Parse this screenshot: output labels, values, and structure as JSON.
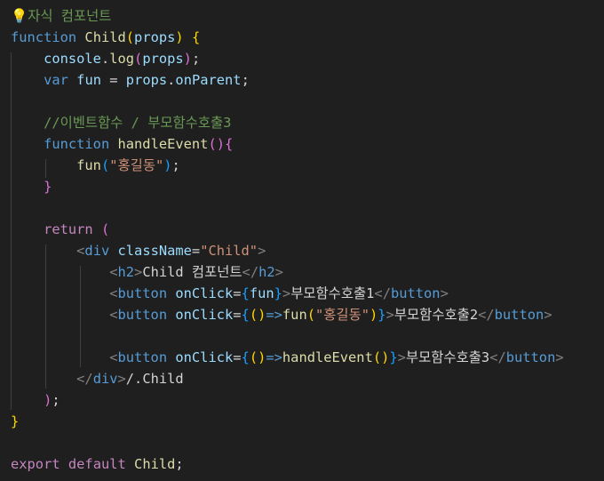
{
  "editor": {
    "language": "jsx",
    "theme_background": "#1f1f1f",
    "lines": [
      {
        "tokens": [
          {
            "t": "💡",
            "c": "bulb",
            "icon": "lightbulb-icon"
          },
          {
            "t": "자식 컴포넌트",
            "c": "c-comment"
          }
        ]
      },
      {
        "tokens": [
          {
            "t": "function",
            "c": "c-kw"
          },
          {
            "t": " ",
            "c": "c-text"
          },
          {
            "t": "Child",
            "c": "c-fn"
          },
          {
            "t": "(",
            "c": "b1"
          },
          {
            "t": "props",
            "c": "c-var"
          },
          {
            "t": ")",
            "c": "b1"
          },
          {
            "t": " ",
            "c": "c-text"
          },
          {
            "t": "{",
            "c": "b1"
          }
        ]
      },
      {
        "tokens": [
          {
            "t": "    ",
            "c": "c-text"
          },
          {
            "t": "console",
            "c": "c-var"
          },
          {
            "t": ".",
            "c": "c-text"
          },
          {
            "t": "log",
            "c": "c-fn"
          },
          {
            "t": "(",
            "c": "b2"
          },
          {
            "t": "props",
            "c": "c-var"
          },
          {
            "t": ")",
            "c": "b2"
          },
          {
            "t": ";",
            "c": "c-text"
          }
        ]
      },
      {
        "tokens": [
          {
            "t": "    ",
            "c": "c-text"
          },
          {
            "t": "var",
            "c": "c-kw"
          },
          {
            "t": " ",
            "c": "c-text"
          },
          {
            "t": "fun",
            "c": "c-var"
          },
          {
            "t": " = ",
            "c": "c-text"
          },
          {
            "t": "props",
            "c": "c-var"
          },
          {
            "t": ".",
            "c": "c-text"
          },
          {
            "t": "onParent",
            "c": "c-var"
          },
          {
            "t": ";",
            "c": "c-text"
          }
        ]
      },
      {
        "tokens": []
      },
      {
        "tokens": [
          {
            "t": "    ",
            "c": "c-text"
          },
          {
            "t": "//이벤트함수 / 부모함수호출3",
            "c": "c-comment"
          }
        ]
      },
      {
        "tokens": [
          {
            "t": "    ",
            "c": "c-text"
          },
          {
            "t": "function",
            "c": "c-kw"
          },
          {
            "t": " ",
            "c": "c-text"
          },
          {
            "t": "handleEvent",
            "c": "c-fn"
          },
          {
            "t": "()",
            "c": "b2"
          },
          {
            "t": "{",
            "c": "b2"
          }
        ]
      },
      {
        "tokens": [
          {
            "t": "        ",
            "c": "c-text"
          },
          {
            "t": "fun",
            "c": "c-fn"
          },
          {
            "t": "(",
            "c": "b3"
          },
          {
            "t": "\"홍길동\"",
            "c": "c-str"
          },
          {
            "t": ")",
            "c": "b3"
          },
          {
            "t": ";",
            "c": "c-text"
          }
        ]
      },
      {
        "tokens": [
          {
            "t": "    ",
            "c": "c-text"
          },
          {
            "t": "}",
            "c": "b2"
          }
        ]
      },
      {
        "tokens": []
      },
      {
        "tokens": [
          {
            "t": "    ",
            "c": "c-text"
          },
          {
            "t": "return",
            "c": "c-ctl"
          },
          {
            "t": " ",
            "c": "c-text"
          },
          {
            "t": "(",
            "c": "b2"
          }
        ]
      },
      {
        "tokens": [
          {
            "t": "        ",
            "c": "c-text"
          },
          {
            "t": "<",
            "c": "c-punc"
          },
          {
            "t": "div",
            "c": "c-tag"
          },
          {
            "t": " ",
            "c": "c-text"
          },
          {
            "t": "className",
            "c": "c-attr"
          },
          {
            "t": "=",
            "c": "c-text"
          },
          {
            "t": "\"Child\"",
            "c": "c-str"
          },
          {
            "t": ">",
            "c": "c-punc"
          }
        ]
      },
      {
        "tokens": [
          {
            "t": "            ",
            "c": "c-text"
          },
          {
            "t": "<",
            "c": "c-punc"
          },
          {
            "t": "h2",
            "c": "c-tag"
          },
          {
            "t": ">",
            "c": "c-punc"
          },
          {
            "t": "Child 컴포넌트",
            "c": "c-text"
          },
          {
            "t": "</",
            "c": "c-punc"
          },
          {
            "t": "h2",
            "c": "c-tag"
          },
          {
            "t": ">",
            "c": "c-punc"
          }
        ]
      },
      {
        "tokens": [
          {
            "t": "            ",
            "c": "c-text"
          },
          {
            "t": "<",
            "c": "c-punc"
          },
          {
            "t": "button",
            "c": "c-tag"
          },
          {
            "t": " ",
            "c": "c-text"
          },
          {
            "t": "onClick",
            "c": "c-attr"
          },
          {
            "t": "=",
            "c": "c-text"
          },
          {
            "t": "{",
            "c": "b3"
          },
          {
            "t": "fun",
            "c": "c-var"
          },
          {
            "t": "}",
            "c": "b3"
          },
          {
            "t": ">",
            "c": "c-punc"
          },
          {
            "t": "부모함수호출1",
            "c": "c-text"
          },
          {
            "t": "</",
            "c": "c-punc"
          },
          {
            "t": "button",
            "c": "c-tag"
          },
          {
            "t": ">",
            "c": "c-punc"
          }
        ]
      },
      {
        "tokens": [
          {
            "t": "            ",
            "c": "c-text"
          },
          {
            "t": "<",
            "c": "c-punc"
          },
          {
            "t": "button",
            "c": "c-tag"
          },
          {
            "t": " ",
            "c": "c-text"
          },
          {
            "t": "onClick",
            "c": "c-attr"
          },
          {
            "t": "=",
            "c": "c-text"
          },
          {
            "t": "{",
            "c": "b3"
          },
          {
            "t": "()",
            "c": "b1"
          },
          {
            "t": "=>",
            "c": "c-kw"
          },
          {
            "t": "fun",
            "c": "c-fn"
          },
          {
            "t": "(",
            "c": "b1"
          },
          {
            "t": "\"홍길동\"",
            "c": "c-str"
          },
          {
            "t": ")",
            "c": "b1"
          },
          {
            "t": "}",
            "c": "b3"
          },
          {
            "t": ">",
            "c": "c-punc"
          },
          {
            "t": "부모함수호출2",
            "c": "c-text"
          },
          {
            "t": "</",
            "c": "c-punc"
          },
          {
            "t": "button",
            "c": "c-tag"
          },
          {
            "t": ">",
            "c": "c-punc"
          }
        ]
      },
      {
        "tokens": []
      },
      {
        "tokens": [
          {
            "t": "            ",
            "c": "c-text"
          },
          {
            "t": "<",
            "c": "c-punc"
          },
          {
            "t": "button",
            "c": "c-tag"
          },
          {
            "t": " ",
            "c": "c-text"
          },
          {
            "t": "onClick",
            "c": "c-attr"
          },
          {
            "t": "=",
            "c": "c-text"
          },
          {
            "t": "{",
            "c": "b3"
          },
          {
            "t": "()",
            "c": "b1"
          },
          {
            "t": "=>",
            "c": "c-kw"
          },
          {
            "t": "handleEvent",
            "c": "c-fn"
          },
          {
            "t": "()",
            "c": "b1"
          },
          {
            "t": "}",
            "c": "b3"
          },
          {
            "t": ">",
            "c": "c-punc"
          },
          {
            "t": "부모함수호출3",
            "c": "c-text"
          },
          {
            "t": "</",
            "c": "c-punc"
          },
          {
            "t": "button",
            "c": "c-tag"
          },
          {
            "t": ">",
            "c": "c-punc"
          }
        ]
      },
      {
        "tokens": [
          {
            "t": "        ",
            "c": "c-text"
          },
          {
            "t": "</",
            "c": "c-punc"
          },
          {
            "t": "div",
            "c": "c-tag"
          },
          {
            "t": ">",
            "c": "c-punc"
          },
          {
            "t": "/.Child",
            "c": "c-text"
          }
        ]
      },
      {
        "tokens": [
          {
            "t": "    ",
            "c": "c-text"
          },
          {
            "t": ")",
            "c": "b2"
          },
          {
            "t": ";",
            "c": "c-text"
          }
        ]
      },
      {
        "tokens": [
          {
            "t": "}",
            "c": "b1"
          }
        ]
      },
      {
        "tokens": []
      },
      {
        "tokens": [
          {
            "t": "export",
            "c": "c-ctl"
          },
          {
            "t": " ",
            "c": "c-text"
          },
          {
            "t": "default",
            "c": "c-ctl"
          },
          {
            "t": " ",
            "c": "c-text"
          },
          {
            "t": "Child",
            "c": "c-fn"
          },
          {
            "t": ";",
            "c": "c-text"
          }
        ]
      }
    ]
  }
}
